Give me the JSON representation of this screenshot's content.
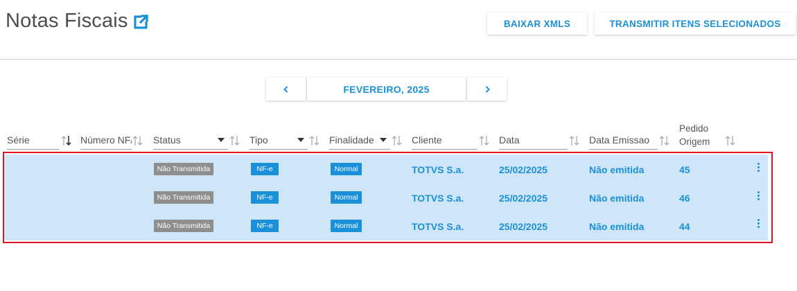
{
  "header": {
    "title": "Notas Fiscais",
    "buttons": {
      "download_xml": "BAIXAR XMLS",
      "transmit_selected": "TRANSMITIR ITENS SELECIONADOS"
    },
    "colors": {
      "accent": "#1a90d8",
      "title": "#4d4d4d"
    }
  },
  "month_nav": {
    "label": "FEVEREIRO, 2025",
    "prev_icon": "chevron-left-icon",
    "next_icon": "chevron-right-icon"
  },
  "table": {
    "columns": {
      "serie": "Série",
      "numero": "Número NF/Item",
      "status": "Status",
      "tipo": "Tipo",
      "finalidade": "Finalidade",
      "cliente": "Cliente",
      "data": "Data",
      "data_emissao": "Data Emissao",
      "pedido_line1": "Pedido",
      "pedido_line2": "Origem"
    },
    "rows": [
      {
        "status": "Não Transmitida",
        "tipo": "NF-e",
        "finalidade": "Normal",
        "cliente": "TOTVS S.a.",
        "data": "25/02/2025",
        "data_emissao": "Não emitida",
        "pedido": "45"
      },
      {
        "status": "Não Transmitida",
        "tipo": "NF-e",
        "finalidade": "Normal",
        "cliente": "TOTVS S.a.",
        "data": "25/02/2025",
        "data_emissao": "Não emitida",
        "pedido": "46"
      },
      {
        "status": "Não Transmitida",
        "tipo": "NF-e",
        "finalidade": "Normal",
        "cliente": "TOTVS S.a.",
        "data": "25/02/2025",
        "data_emissao": "Não emitida",
        "pedido": "44"
      }
    ],
    "colors": {
      "selected_row_bg": "#cfe6f8",
      "highlight_border": "#e0141e",
      "status_badge": "#8e8e8e",
      "tag_badge": "#1a90d8"
    }
  }
}
